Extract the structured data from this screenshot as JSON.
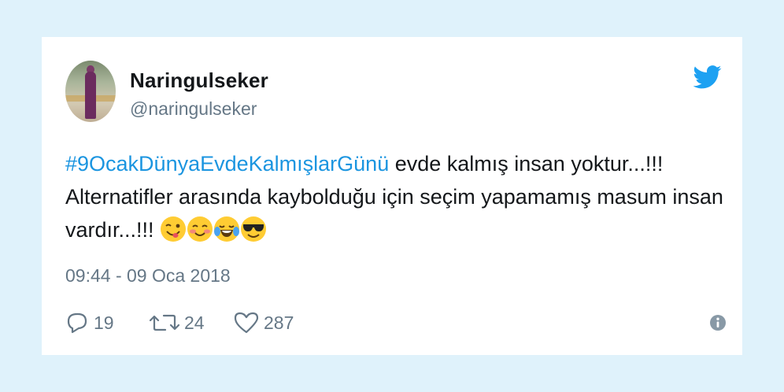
{
  "tweet": {
    "display_name": "Naringulseker",
    "handle": "@naringulseker",
    "hashtag": "#9OcakDünyaEvdeKalmışlarGünü",
    "text_after_hashtag": " evde kalmış insan yoktur...!!! Alternatifler arasında kaybolduğu için seçim yapamamış masum insan vardır...!!! ",
    "emojis": [
      "winking-face-with-tongue",
      "smiling-face-with-blush",
      "face-with-tears-of-joy",
      "smiling-face-with-sunglasses"
    ],
    "timestamp": "09:44 - 09 Oca 2018",
    "stats": {
      "replies": "19",
      "retweets": "24",
      "likes": "287"
    }
  },
  "icons": {
    "brand": "twitter-bird-icon",
    "reply": "reply-bubble-icon",
    "retweet": "retweet-icon",
    "like": "heart-icon",
    "info": "info-icon"
  },
  "colors": {
    "background": "#dff2fb",
    "card": "#ffffff",
    "accent": "#1b95e0",
    "text": "#14171a",
    "muted": "#657786"
  }
}
